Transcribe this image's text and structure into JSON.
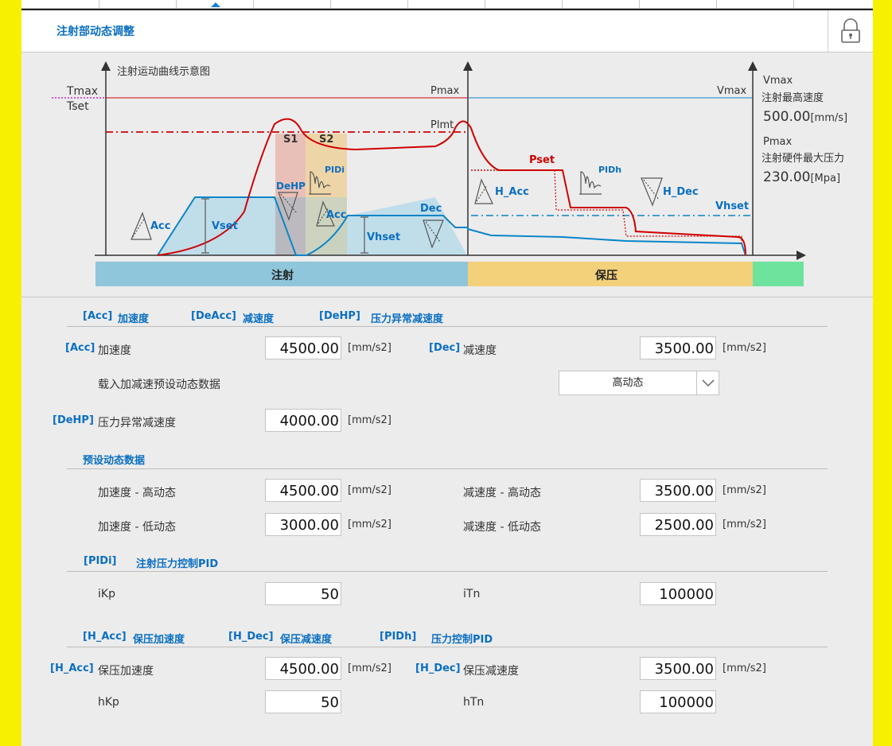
{
  "header": {
    "title": "注射部动态调整"
  },
  "diagram": {
    "caption": "注射运动曲线示意图",
    "labels": {
      "tmax": "Tmax",
      "tset": "Tset",
      "pmax_left": "Pmax",
      "vmax_mid": "Vmax",
      "plmt": "Plmt",
      "s1": "S1",
      "s2": "S2",
      "pidi": "PIDi",
      "dehp": "DeHP",
      "acc1": "Acc",
      "vset": "Vset",
      "acc2": "Acc",
      "vhset1": "Vhset",
      "dec": "Dec",
      "pset": "Pset",
      "pidh": "PIDh",
      "h_acc": "H_Acc",
      "h_dec": "H_Dec",
      "vhset2": "Vhset"
    },
    "vmax_title": "Vmax",
    "vmax_desc": "注射最高速度",
    "vmax_value": "500.00",
    "vmax_unit": "[mm/s]",
    "pmax_title": "Pmax",
    "pmax_desc": "注射硬件最大压力",
    "pmax_value": "230.00",
    "pmax_unit": "[Mpa]",
    "phase_inject": "注射",
    "phase_hold": "保压",
    "colors": {
      "inject": "#8fc6dc",
      "hold": "#f3d07a",
      "end": "#6de39e",
      "pressure": "#d00000",
      "speed": "#0a85c8"
    }
  },
  "sections": {
    "acc_header": {
      "tag1": "[Acc]",
      "name1": "加速度",
      "tag2": "[DeAcc]",
      "name2": "减速度",
      "tag3": "[DeHP]",
      "name3": "压力异常减速度"
    },
    "preset_header": "预设动态数据",
    "pidi_header": {
      "tag": "[PIDi]",
      "name": "注射压力控制PID"
    },
    "hold_header": {
      "tag1": "[H_Acc]",
      "name1": "保压加速度",
      "tag2": "[H_Dec]",
      "name2": "保压减速度",
      "tag3": "[PIDh]",
      "name3": "压力控制PID"
    }
  },
  "fields": {
    "acc": {
      "tag": "[Acc]",
      "label": "加速度",
      "value": "4500.00",
      "unit": "[mm/s2]"
    },
    "dec": {
      "tag": "[Dec]",
      "label": "减速度",
      "value": "3500.00",
      "unit": "[mm/s2]"
    },
    "load_preset": {
      "label": "载入加减速预设动态数据",
      "selected": "高动态"
    },
    "dehp": {
      "tag": "[DeHP]",
      "label": "压力异常减速度",
      "value": "4000.00",
      "unit": "[mm/s2]"
    },
    "acc_high": {
      "label": "加速度 - 高动态",
      "value": "4500.00",
      "unit": "[mm/s2]"
    },
    "dec_high": {
      "label": "减速度 - 高动态",
      "value": "3500.00",
      "unit": "[mm/s2]"
    },
    "acc_low": {
      "label": "加速度 - 低动态",
      "value": "3000.00",
      "unit": "[mm/s2]"
    },
    "dec_low": {
      "label": "减速度 - 低动态",
      "value": "2500.00",
      "unit": "[mm/s2]"
    },
    "ikp": {
      "label": "iKp",
      "value": "50"
    },
    "itn": {
      "label": "iTn",
      "value": "100000"
    },
    "h_acc": {
      "tag": "[H_Acc]",
      "label": "保压加速度",
      "value": "4500.00",
      "unit": "[mm/s2]"
    },
    "h_dec": {
      "tag": "[H_Dec]",
      "label": "保压减速度",
      "value": "3500.00",
      "unit": "[mm/s2]"
    },
    "hkp": {
      "label": "hKp",
      "value": "50"
    },
    "htn": {
      "label": "hTn",
      "value": "100000"
    }
  }
}
